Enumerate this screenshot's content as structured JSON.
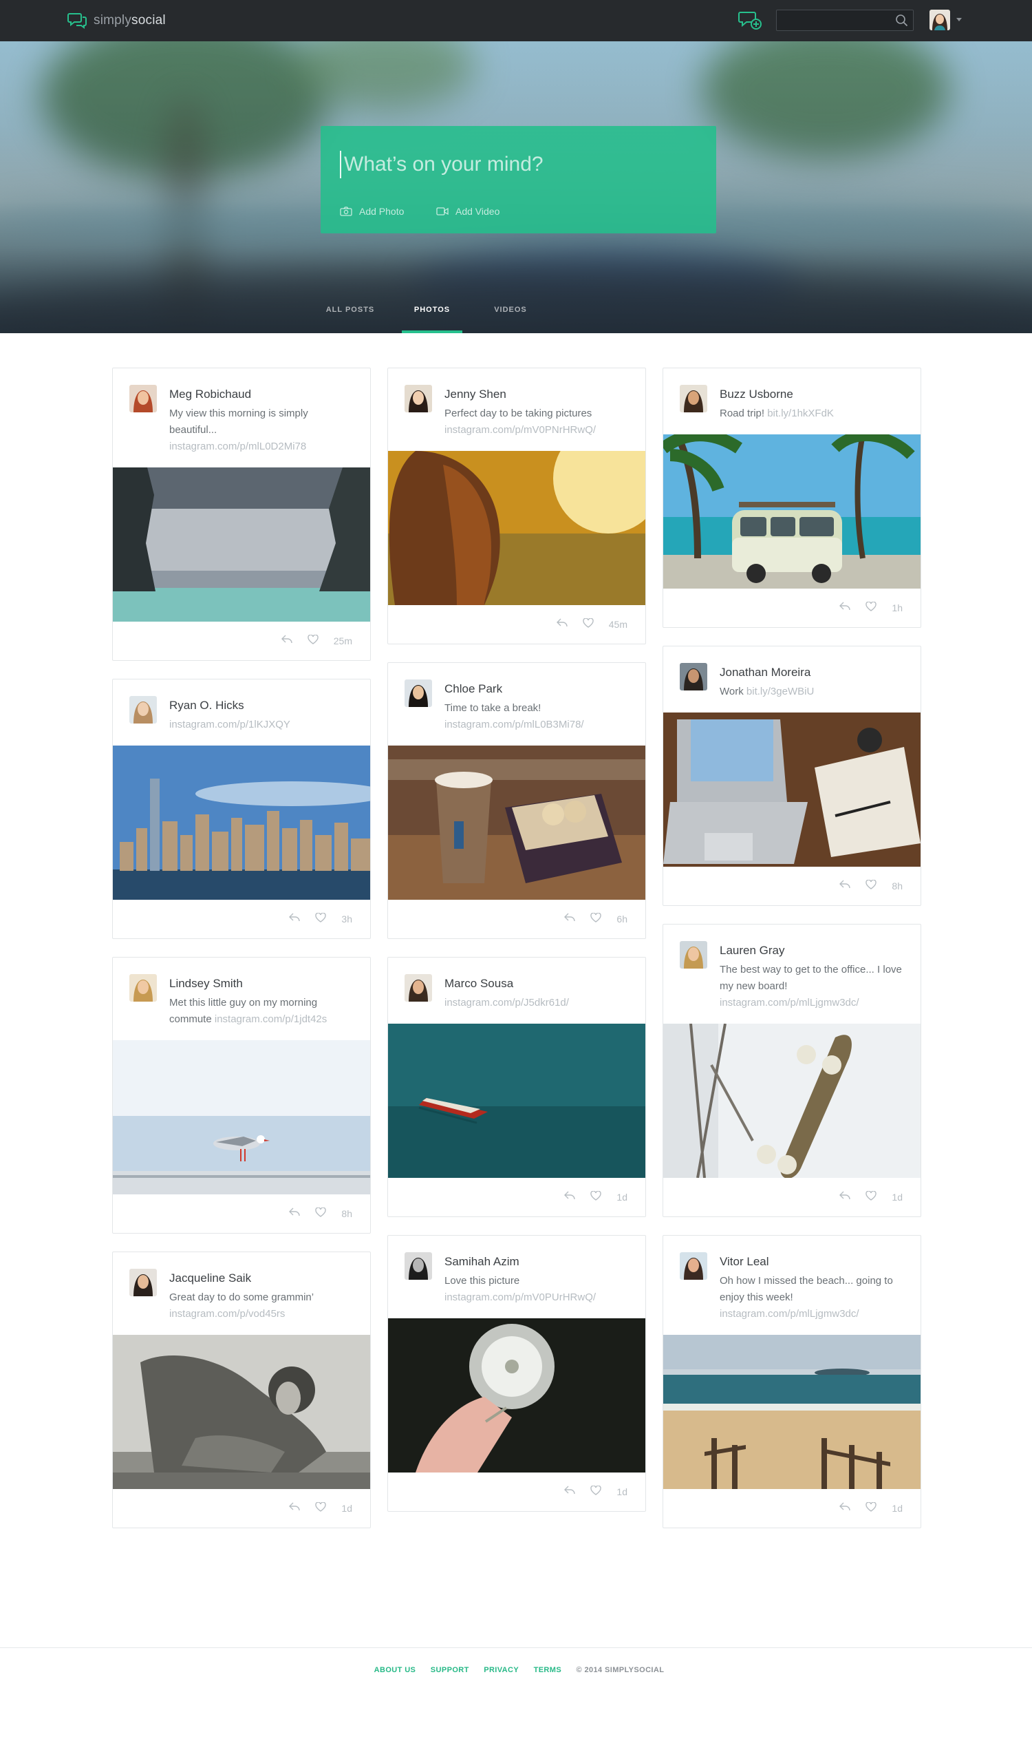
{
  "app": {
    "logo_light": "simply",
    "logo_bold": "social",
    "accent": "#27c08d",
    "topbar_bg": "#272a2d"
  },
  "search": {
    "placeholder": "",
    "value": ""
  },
  "composer": {
    "placeholder": "What’s on your mind?",
    "add_photo": "Add Photo",
    "add_video": "Add Video"
  },
  "tabs": [
    {
      "label": "ALL POSTS",
      "active": false
    },
    {
      "label": "PHOTOS",
      "active": true
    },
    {
      "label": "VIDEOS",
      "active": false
    }
  ],
  "columns": [
    [
      {
        "name": "Meg Robichaud",
        "text": "My view this morning is simply beautiful...",
        "link": "instagram.com/p/mlL0D2Mi78",
        "link_newline": true,
        "time": "25m",
        "photo": "cliffs",
        "avatar": "woman-red"
      },
      {
        "name": "Ryan O. Hicks",
        "text": "",
        "link": "instagram.com/p/1lKJXQY",
        "link_newline": true,
        "time": "3h",
        "photo": "city",
        "avatar": "man-light"
      },
      {
        "name": "Lindsey Smith",
        "text": "Met this little guy on my morning commute",
        "link": "instagram.com/p/1jdt42s",
        "link_newline": false,
        "time": "8h",
        "photo": "seagull",
        "avatar": "woman-blonde"
      },
      {
        "name": "Jacqueline Saik",
        "text": "Great day to do some grammin’",
        "link": "instagram.com/p/vod45rs",
        "link_newline": true,
        "time": "1d",
        "photo": "bw-girl",
        "avatar": "woman-dark"
      }
    ],
    [
      {
        "name": "Jenny Shen",
        "text": "Perfect day to be taking pictures",
        "link": "instagram.com/p/mV0PNrHRwQ/",
        "link_newline": true,
        "time": "45m",
        "photo": "sunset-hair",
        "avatar": "woman-asian"
      },
      {
        "name": "Chloe Park",
        "text": "Time to take a break!",
        "link": "instagram.com/p/mlL0B3Mi78/",
        "link_newline": true,
        "time": "6h",
        "photo": "coffee",
        "avatar": "woman-asian2"
      },
      {
        "name": "Marco Sousa",
        "text": "",
        "link": "instagram.com/p/J5dkr61d/",
        "link_newline": true,
        "time": "1d",
        "photo": "boat",
        "avatar": "man-glasses"
      },
      {
        "name": "Samihah Azim",
        "text": "Love this picture",
        "link": "instagram.com/p/mV0PUrHRwQ/",
        "link_newline": true,
        "time": "1d",
        "photo": "dandelion",
        "avatar": "woman-bw"
      }
    ],
    [
      {
        "name": "Buzz Usborne",
        "text": "Road trip!",
        "link": "bit.ly/1hkXFdK",
        "link_newline": false,
        "time": "1h",
        "photo": "van",
        "avatar": "man-shades"
      },
      {
        "name": "Jonathan Moreira",
        "text": "Work",
        "link": "bit.ly/3geWBiU",
        "link_newline": false,
        "time": "8h",
        "photo": "laptop",
        "avatar": "man-dark"
      },
      {
        "name": "Lauren Gray",
        "text": "The best way to get to the office... I love my new board!",
        "link": "instagram.com/p/mlLjgmw3dc/",
        "link_newline": true,
        "time": "1d",
        "photo": "skateboard",
        "avatar": "woman-sunglasses"
      },
      {
        "name": "Vitor Leal",
        "text": "Oh how I missed the beach... going to enjoy this week!",
        "link": "instagram.com/p/mlLjgmw3dc/",
        "link_newline": true,
        "time": "1d",
        "photo": "beach",
        "avatar": "man-red"
      }
    ]
  ],
  "footer": {
    "links": [
      "ABOUT US",
      "SUPPORT",
      "PRIVACY",
      "TERMS"
    ],
    "copyright": "© 2014 SIMPLYSOCIAL"
  }
}
